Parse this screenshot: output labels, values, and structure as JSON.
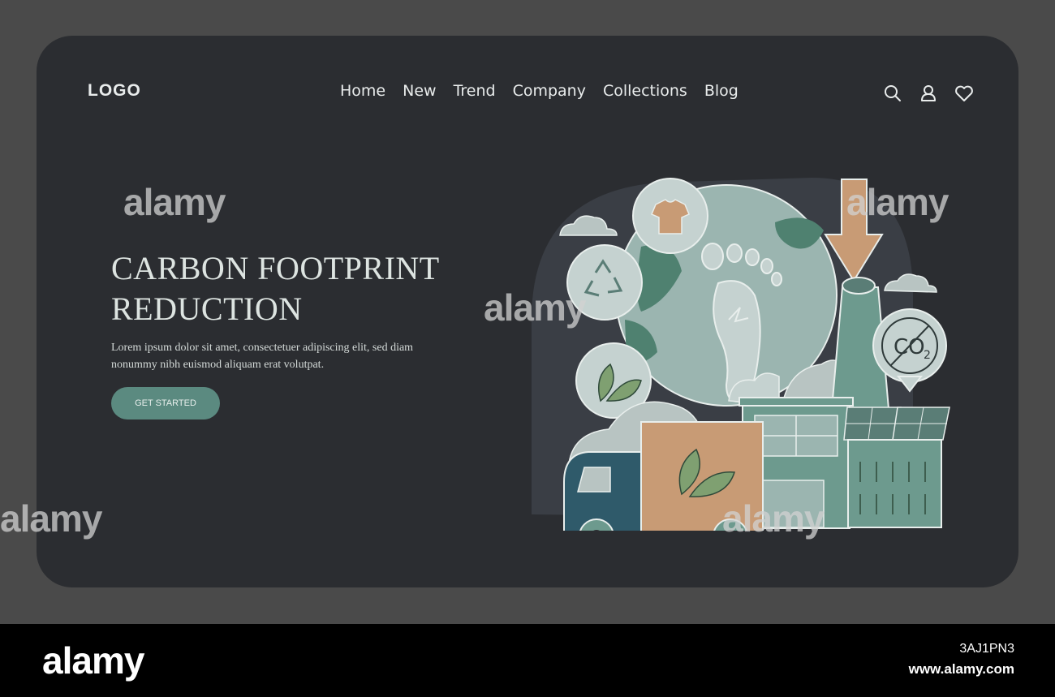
{
  "header": {
    "logo": "LOGO",
    "nav": [
      "Home",
      "New",
      "Trend",
      "Company",
      "Collections",
      "Blog"
    ],
    "icons": [
      "search-icon",
      "user-icon",
      "heart-icon"
    ]
  },
  "hero": {
    "title_line1": "CARBON FOOTPRINT",
    "title_line2": "REDUCTION",
    "description": "Lorem ipsum dolor sit amet, consectetuer adipiscing elit, sed diam nonummy nibh euismod aliquam erat volutpat.",
    "cta_label": "GET STARTED"
  },
  "illustration": {
    "co2_label": "CO",
    "co2_subscript": "2"
  },
  "watermark": {
    "brand": "alamy",
    "image_id": "3AJ1PN3",
    "url": "www.alamy.com"
  },
  "colors": {
    "page_bg": "#4a4a4a",
    "card_bg": "#2b2d31",
    "accent": "#5b8a80",
    "globe": "#9bb5b0",
    "box": "#c89b75",
    "truck": "#2f5a6a"
  }
}
